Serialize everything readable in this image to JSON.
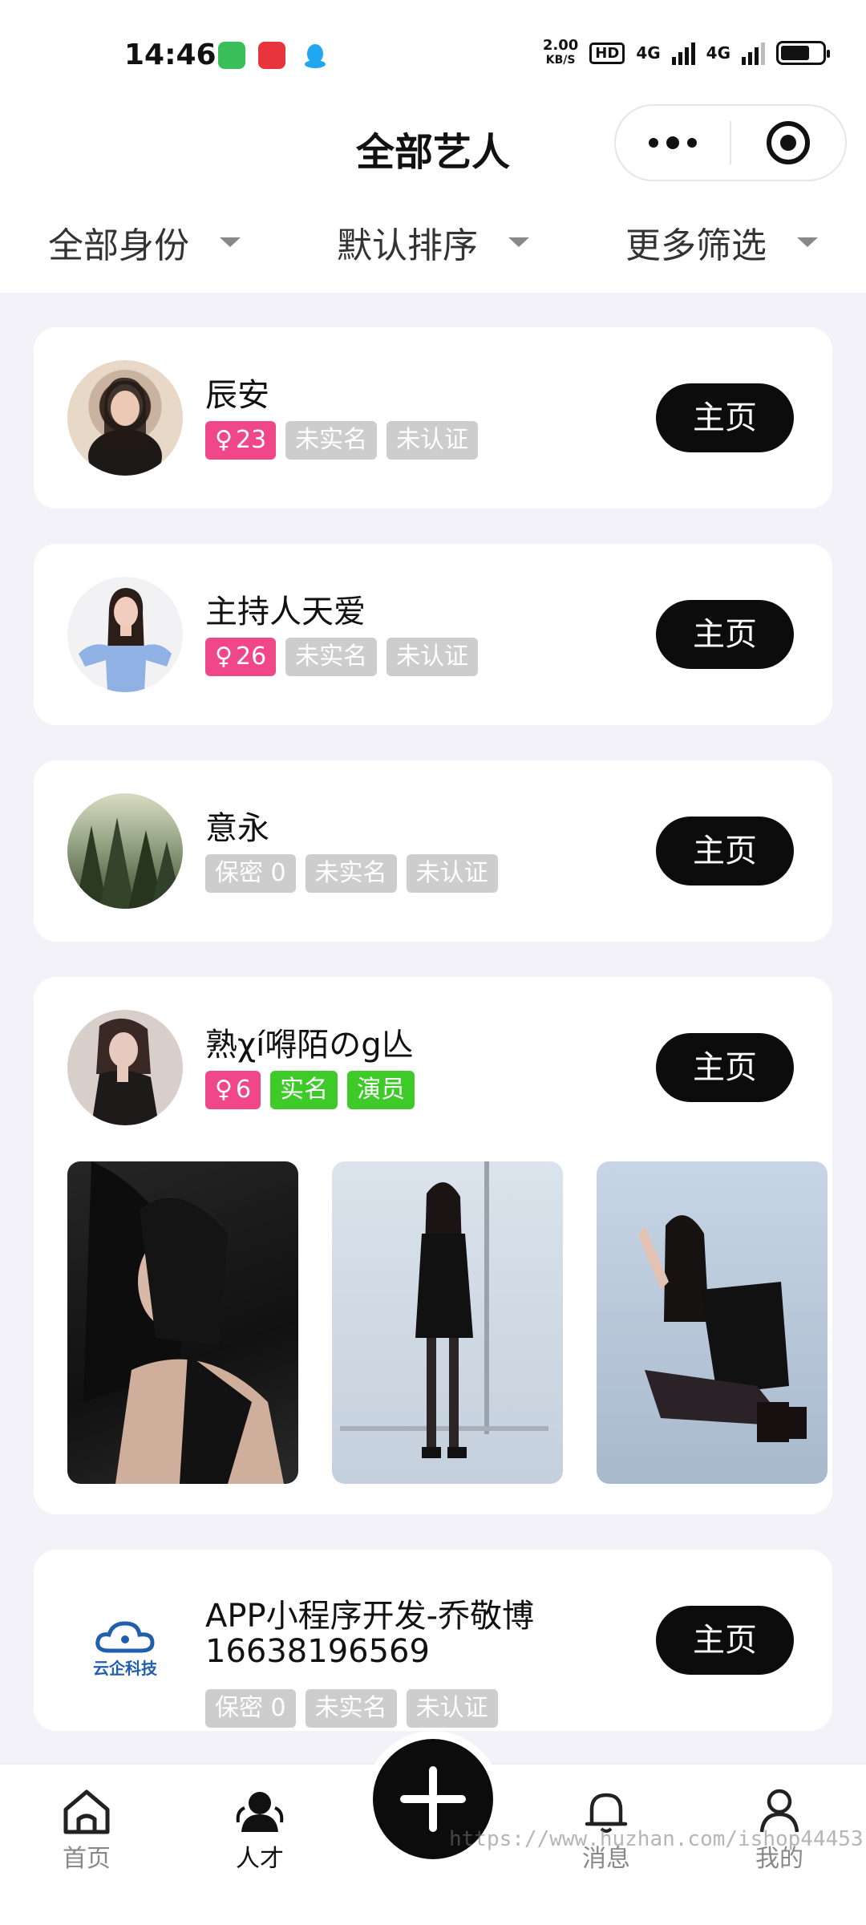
{
  "status_bar": {
    "time": "14:46",
    "speed_value": "2.00",
    "speed_unit": "KB/S",
    "hd": "HD",
    "network_1": "4G",
    "network_2": "4G",
    "battery_level": 0.7
  },
  "header": {
    "title": "全部艺人"
  },
  "filters": [
    {
      "label": "全部身份"
    },
    {
      "label": "默认排序"
    },
    {
      "label": "更多筛选"
    }
  ],
  "home_label": "主页",
  "artists": [
    {
      "name": "辰安",
      "tags": [
        "23",
        "未实名",
        "未认证"
      ]
    },
    {
      "name": "主持人天爱",
      "tags": [
        "26",
        "未实名",
        "未认证"
      ]
    },
    {
      "name": "意永",
      "tags": [
        "保密 0",
        "未实名",
        "未认证"
      ]
    },
    {
      "name": "熟χí嘚陌のg亾",
      "tags": [
        "6",
        "实名",
        "演员"
      ]
    },
    {
      "name": "APP小程序开发-乔敬博",
      "phone": "16638196569",
      "tags": [
        "保密 0",
        "未实名",
        "未认证"
      ],
      "logo_text": "云企科技"
    }
  ],
  "nav": {
    "items": [
      {
        "label": "首页",
        "icon": "home-icon"
      },
      {
        "label": "人才",
        "icon": "people-icon"
      },
      {
        "label": "消息",
        "icon": "bell-icon"
      },
      {
        "label": "我的",
        "icon": "person-icon"
      }
    ],
    "fab_icon": "plus-icon",
    "watermark": "https://www.huzhan.com/ishop44453"
  },
  "colors": {
    "accent": "#0c0c0c",
    "tag_pink": "#f0468a",
    "tag_green": "#3ecb2a",
    "tag_grey": "#cdcdcd",
    "background": "#f3f2f8"
  }
}
